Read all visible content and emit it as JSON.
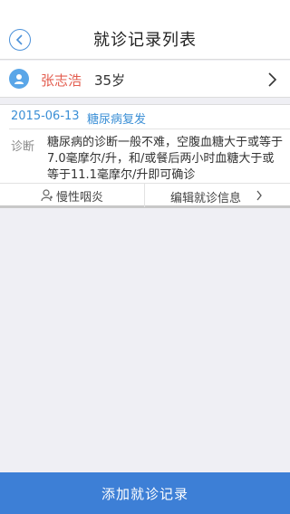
{
  "header": {
    "title": "就诊记录列表",
    "back_icon": "back-arrow-circle-icon"
  },
  "patient": {
    "name": "张志浩",
    "age": "35岁",
    "avatar_icon": "user-avatar-icon",
    "chevron_icon": "chevron-right-icon"
  },
  "records": [
    {
      "date": "2015-06-13",
      "disease": "糖尿病复发",
      "diagnosis_label": "诊断",
      "diagnosis_text": "糖尿病的诊断一般不难，空腹血糖大于或等于7.0毫摩尔/升，和/或餐后两小时血糖大于或等于11.1毫摩尔/升即可确诊",
      "chronic_label": "慢性咽炎",
      "edit_label": "编辑就诊信息"
    }
  ],
  "footer": {
    "add_label": "添加就诊记录"
  },
  "colors": {
    "accent": "#3d7fd6",
    "link": "#3b8fd6",
    "name": "#e35d4f",
    "background": "#efeff4"
  }
}
